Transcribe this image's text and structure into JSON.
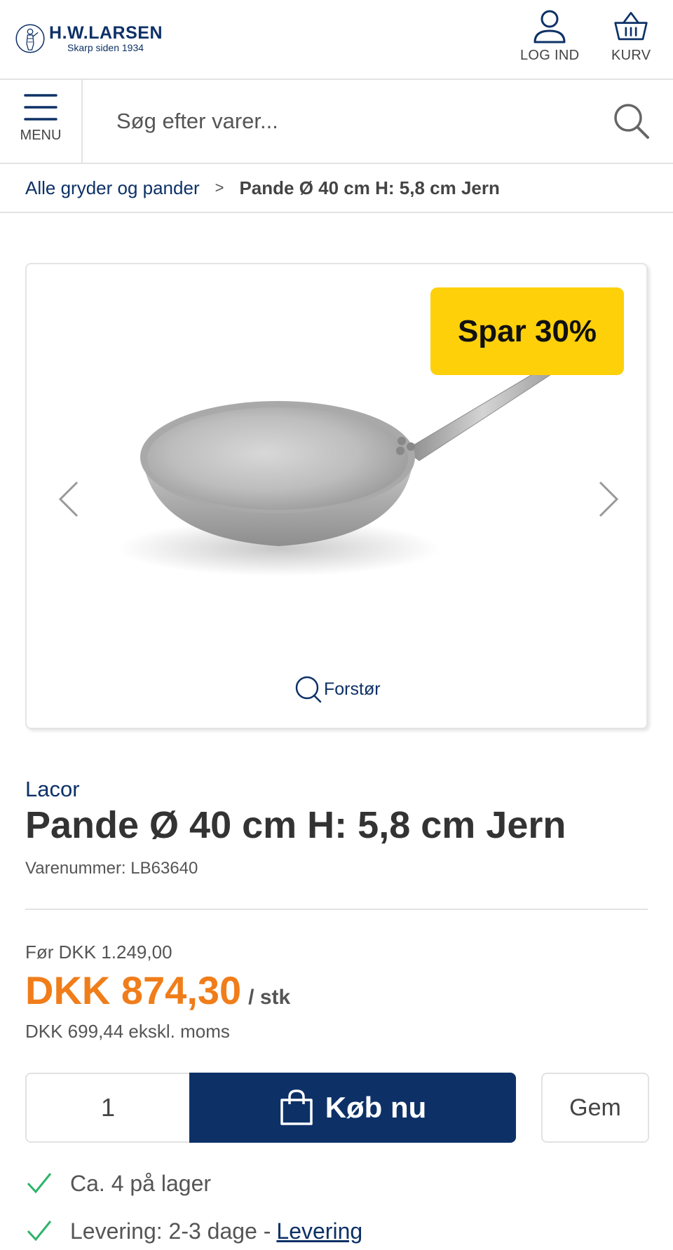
{
  "header": {
    "logo": {
      "name": "H.W.LARSEN",
      "tagline": "Skarp siden 1934"
    },
    "login_label": "LOG IND",
    "cart_label": "KURV"
  },
  "search": {
    "menu_label": "MENU",
    "placeholder": "Søg efter varer..."
  },
  "breadcrumb": {
    "parent": "Alle gryder og pander",
    "separator": ">",
    "current": "Pande Ø 40 cm H: 5,8 cm Jern"
  },
  "gallery": {
    "badge": "Spar 30%",
    "zoom_label": "Forstør",
    "badge_color": "#fdd00a"
  },
  "product": {
    "brand": "Lacor",
    "title": "Pande Ø 40 cm H: 5,8 cm Jern",
    "sku": "Varenummer: LB63640"
  },
  "pricing": {
    "old_price": "Før DKK 1.249,00",
    "price": "DKK 874,30",
    "unit": "/ stk",
    "ex_vat": "DKK 699,44 ekskl. moms",
    "price_color": "#f07d1a"
  },
  "purchase": {
    "quantity": "1",
    "buy_label": "Køb nu",
    "save_label": "Gem",
    "brand_color": "#0d3167"
  },
  "availability": {
    "stock": "Ca. 4 på lager",
    "delivery_text": "Levering: 2-3 dage -",
    "delivery_link": "Levering",
    "check_color": "#2db36a"
  }
}
